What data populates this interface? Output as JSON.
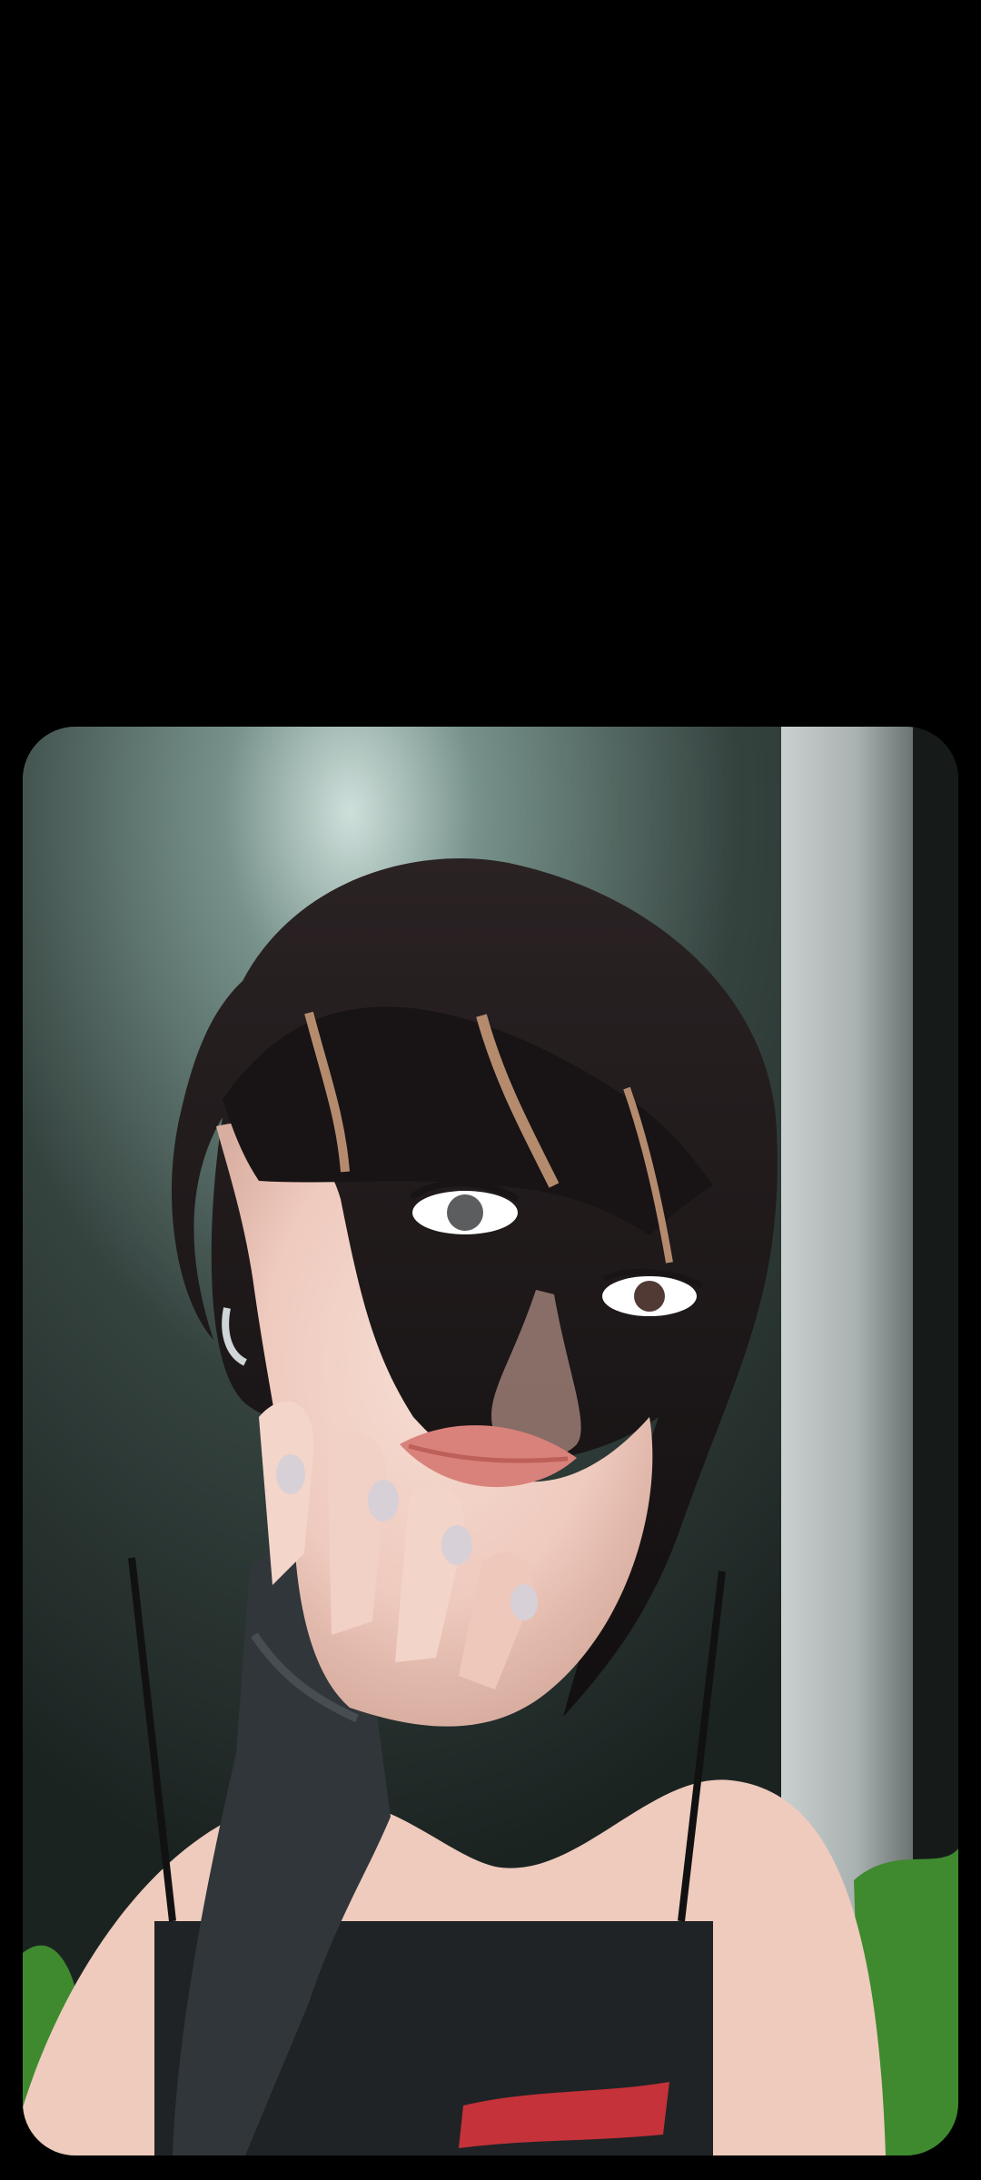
{
  "screen": {
    "background": "#000000"
  },
  "photo": {
    "kind": "portrait",
    "palette": {
      "wall": "#35433f",
      "wall_highlight": "#cfe0db",
      "pillar": "#b8bdbd",
      "hair": "#1a1516",
      "hair_highlight": "#b58b6e",
      "skin": "#f0d2c7",
      "skin_shadow": "#d8aea0",
      "lips": "#d9827b",
      "clothing": "#1f2325",
      "sleeve": "#30363a",
      "grass": "#3f8a2f",
      "text_print": "#d7343c"
    }
  }
}
